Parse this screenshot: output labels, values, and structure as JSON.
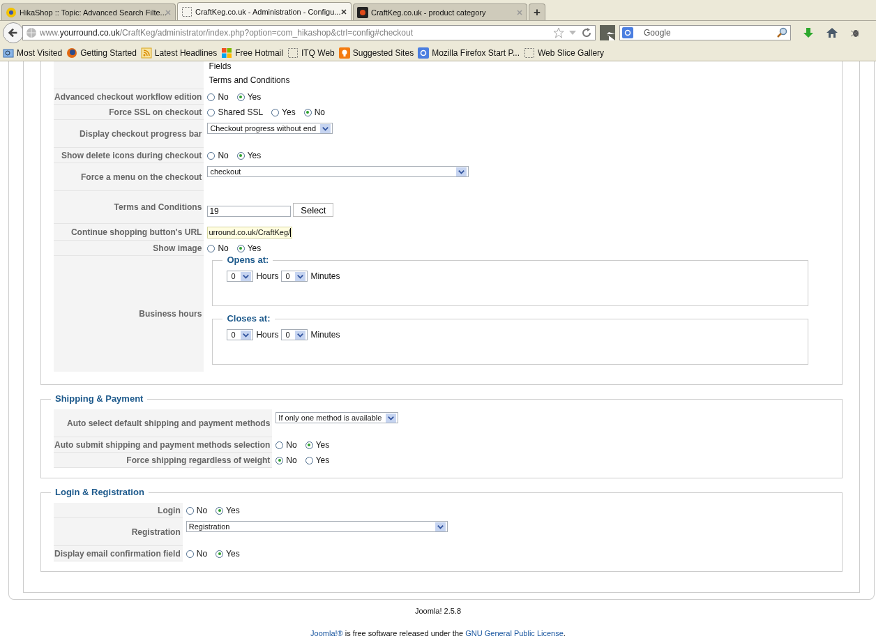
{
  "browser": {
    "tabs": [
      {
        "title": "HikaShop :: Topic: Advanced Search Filte...",
        "selected": false
      },
      {
        "title": "CraftKeg.co.uk - Administration - Configu...",
        "selected": true
      },
      {
        "title": "CraftKeg.co.uk - product category",
        "selected": false
      }
    ],
    "new_tab": "+",
    "url": {
      "prefix": "www.",
      "host": "yourround.co.uk",
      "path": "/CraftKeg/administrator/index.php?option=com_hikashop&ctrl=config#checkout"
    },
    "search": {
      "placeholder": "Google"
    },
    "bookmarks": [
      {
        "label": "Most Visited"
      },
      {
        "label": "Getting Started"
      },
      {
        "label": "Latest Headlines"
      },
      {
        "label": "Free Hotmail"
      },
      {
        "label": "ITQ Web"
      },
      {
        "label": "Suggested Sites"
      },
      {
        "label": "Mozilla Firefox Start P..."
      },
      {
        "label": "Web Slice Gallery"
      }
    ]
  },
  "sections": [
    {
      "rows": [
        {
          "kind": "lines",
          "lines": [
            "Fields",
            "Terms and Conditions"
          ]
        },
        {
          "kind": "radio",
          "label": "Advanced checkout workflow edition",
          "options": [
            {
              "label": "No",
              "selected": false
            },
            {
              "label": "Yes",
              "selected": true
            }
          ]
        },
        {
          "kind": "radio",
          "label": "Force SSL on checkout",
          "options": [
            {
              "label": "Shared SSL",
              "selected": false
            },
            {
              "label": "Yes",
              "selected": false
            },
            {
              "label": "No",
              "selected": true
            }
          ]
        },
        {
          "kind": "select",
          "label": "Display checkout progress bar",
          "value": "Checkout progress without end"
        },
        {
          "kind": "radio",
          "label": "Show delete icons during checkout",
          "options": [
            {
              "label": "No",
              "selected": false
            },
            {
              "label": "Yes",
              "selected": true
            }
          ]
        },
        {
          "kind": "select",
          "label": "Force a menu on the checkout",
          "value": "checkout"
        },
        {
          "kind": "text_button",
          "label": "Terms and Conditions",
          "value": "19",
          "button": "Select"
        },
        {
          "kind": "input",
          "label": "Continue shopping button's URL",
          "value": "urround.co.uk/CraftKeg/"
        },
        {
          "kind": "radio",
          "label": "Show image",
          "options": [
            {
              "label": "No",
              "selected": false
            },
            {
              "label": "Yes",
              "selected": true
            }
          ]
        },
        {
          "kind": "hours",
          "label": "Business hours",
          "groups": [
            {
              "title": "Opens at:",
              "hours": "0",
              "hours_label": "Hours",
              "minutes": "0",
              "minutes_label": "Minutes"
            },
            {
              "title": "Closes at:",
              "hours": "0",
              "hours_label": "Hours",
              "minutes": "0",
              "minutes_label": "Minutes"
            }
          ]
        }
      ]
    },
    {
      "title": "Shipping & Payment",
      "rows": [
        {
          "kind": "select",
          "label": "Auto select default shipping and payment methods",
          "value": "If only one method is available"
        },
        {
          "kind": "radio",
          "label": "Auto submit shipping and payment methods selection",
          "options": [
            {
              "label": "No",
              "selected": false
            },
            {
              "label": "Yes",
              "selected": true
            }
          ]
        },
        {
          "kind": "radio",
          "label": "Force shipping regardless of weight",
          "options": [
            {
              "label": "No",
              "selected": true
            },
            {
              "label": "Yes",
              "selected": false
            }
          ]
        }
      ]
    },
    {
      "title": "Login & Registration",
      "rows": [
        {
          "kind": "radio",
          "label": "Login",
          "options": [
            {
              "label": "No",
              "selected": false
            },
            {
              "label": "Yes",
              "selected": true
            }
          ]
        },
        {
          "kind": "select",
          "label": "Registration",
          "value": "Registration"
        },
        {
          "kind": "radio",
          "label": "Display email confirmation field",
          "options": [
            {
              "label": "No",
              "selected": false
            },
            {
              "label": "Yes",
              "selected": true
            }
          ]
        }
      ]
    }
  ],
  "footer": {
    "version": "Joomla! 2.5.8",
    "license": {
      "link1": "Joomla!®",
      "text": " is free software released under the ",
      "link2": "GNU General Public License",
      "end": "."
    }
  }
}
